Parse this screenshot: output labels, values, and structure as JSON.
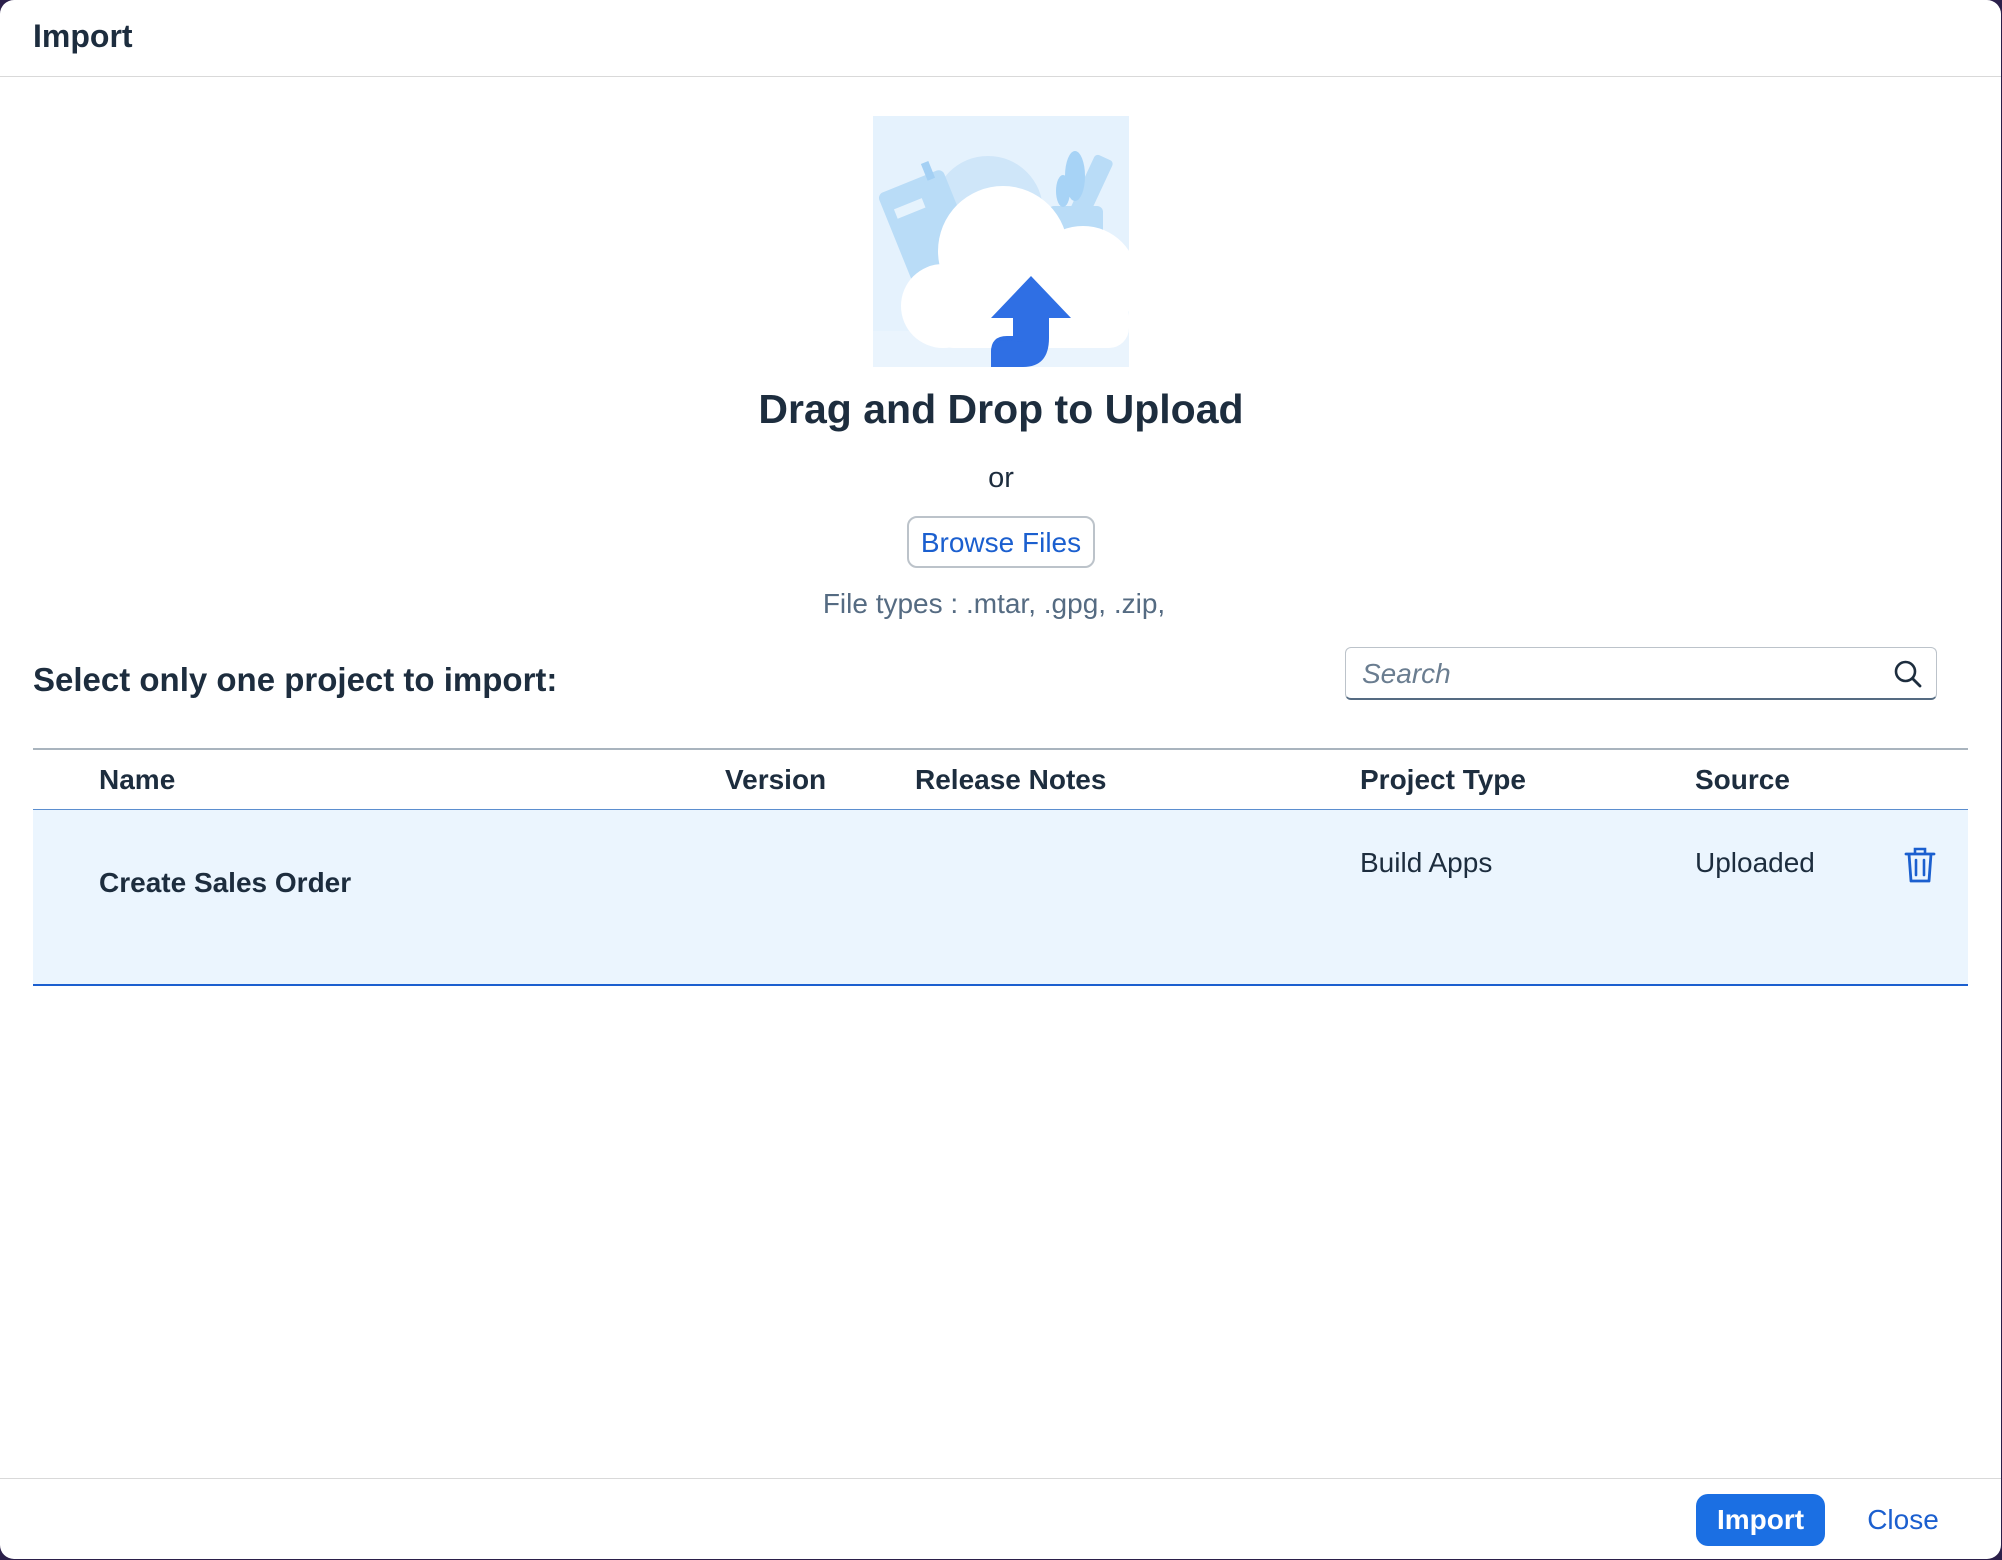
{
  "dialog": {
    "title": "Import"
  },
  "upload": {
    "illustration_icon": "cloud-upload-illustration",
    "title": "Drag and Drop to Upload",
    "or_text": "or",
    "browse_label": "Browse Files",
    "file_types": "File types : .mtar, .gpg, .zip,"
  },
  "selection": {
    "label": "Select only one project to import:",
    "search_placeholder": "Search",
    "search_icon": "search-icon"
  },
  "table": {
    "columns": [
      "Name",
      "Version",
      "Release Notes",
      "Project Type",
      "Source"
    ],
    "rows": [
      {
        "name": "Create Sales Order",
        "version": "",
        "release_notes": "",
        "project_type": "Build Apps",
        "source": "Uploaded",
        "action_icon": "trash-icon"
      }
    ]
  },
  "footer": {
    "import_label": "Import",
    "close_label": "Close"
  },
  "colors": {
    "accent": "#1b6fe3",
    "link": "#1b5fcf",
    "selected_row": "#ebf5fe",
    "text": "#1d2d3e"
  }
}
